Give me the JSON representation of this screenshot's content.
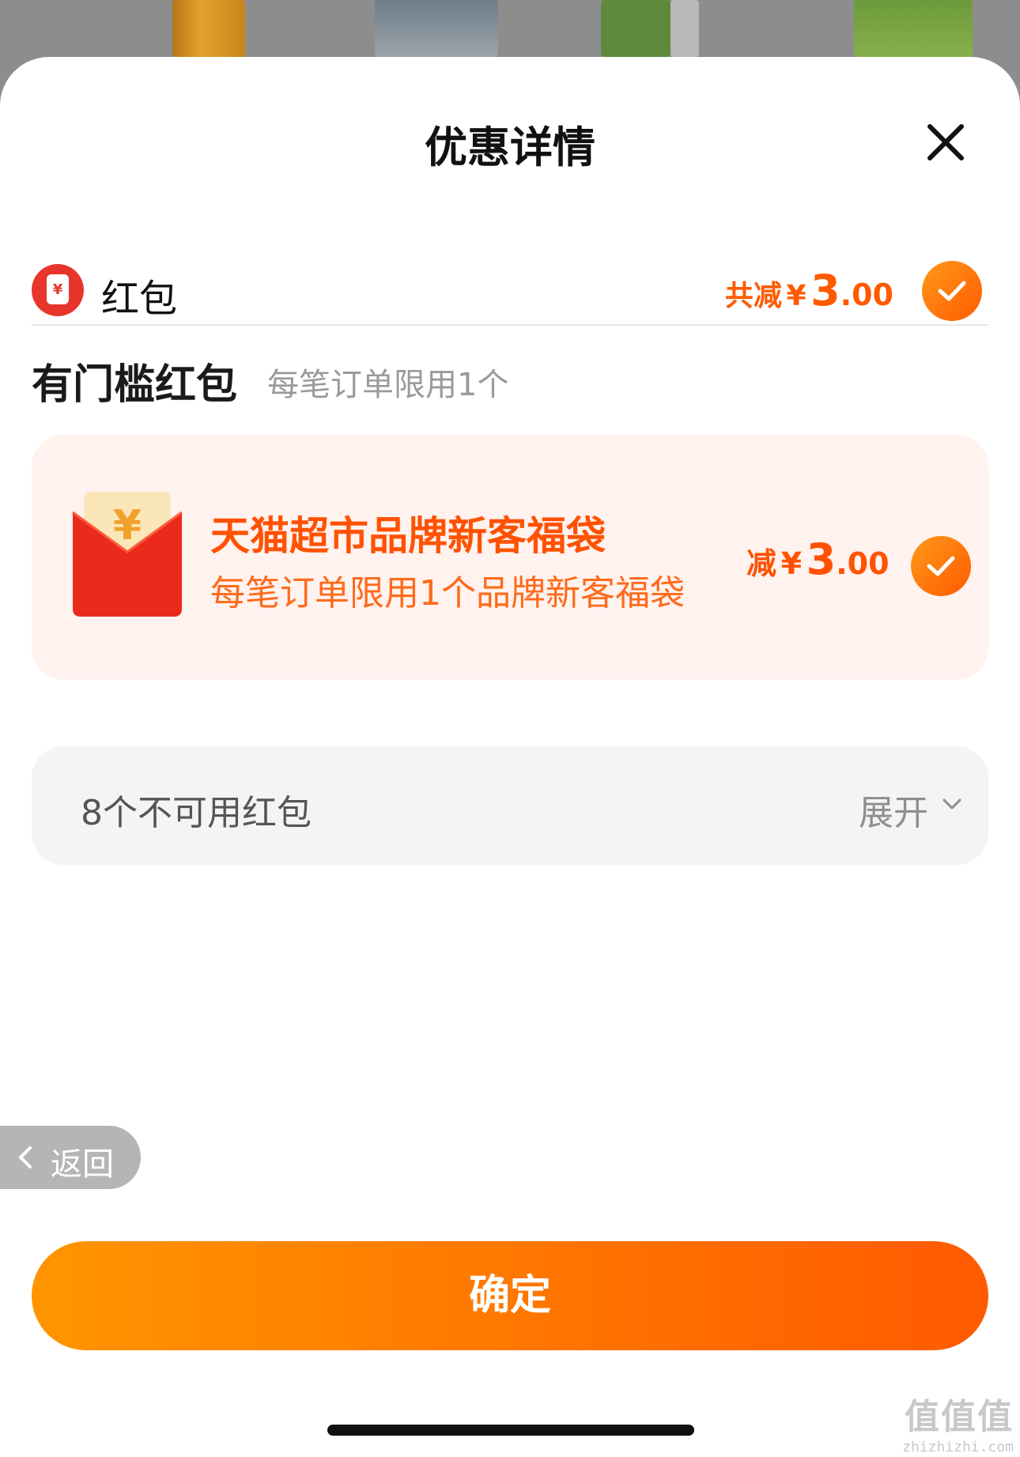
{
  "header": {
    "title": "优惠详情"
  },
  "red_packet": {
    "label": "红包",
    "icon_glyph": "¥",
    "total_prefix": "共减",
    "currency": "¥",
    "amount_int": "3",
    "amount_dec": ".00",
    "checked": true
  },
  "threshold": {
    "title": "有门槛红包",
    "subtitle": "每笔订单限用1个"
  },
  "coupon": {
    "title": "天猫超市品牌新客福袋",
    "description": "每笔订单限用1个品牌新客福袋",
    "amount_prefix": "减",
    "currency": "¥",
    "amount_int": "3",
    "amount_dec": ".00",
    "checked": true
  },
  "unavailable": {
    "label": "8个不可用红包",
    "expand_label": "展开"
  },
  "back": {
    "label": "返回"
  },
  "confirm": {
    "label": "确定"
  },
  "watermark": {
    "text": "值值值",
    "url": "zhizhizhi.com"
  },
  "colors": {
    "accent": "#ff5a00",
    "accent_light": "#ff9500",
    "coupon_bg": "#fff2ef",
    "red_icon": "#e8352c"
  },
  "icons": [
    "close-icon",
    "red-packet-icon",
    "check-icon",
    "envelope-icon",
    "chevron-down-icon",
    "chevron-left-icon"
  ]
}
